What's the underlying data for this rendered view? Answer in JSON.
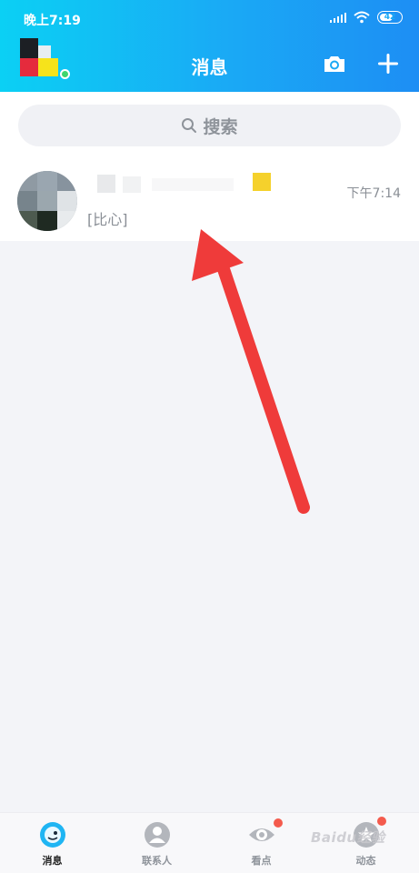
{
  "status_bar": {
    "time": "晚上7:19",
    "battery": "42"
  },
  "header": {
    "title": "消息"
  },
  "search": {
    "placeholder": "搜索"
  },
  "conversations": [
    {
      "preview": "[比心]",
      "time": "下午7:14"
    }
  ],
  "tabs": [
    {
      "label": "消息",
      "active": true
    },
    {
      "label": "联系人",
      "active": false
    },
    {
      "label": "看点",
      "active": false
    },
    {
      "label": "动态",
      "active": false
    }
  ],
  "watermark": "Baidu经验",
  "colors": {
    "header_start": "#0bd0f4",
    "header_end": "#1d8ef4",
    "arrow": "#ef3b3a",
    "badge": "#f45b4d"
  }
}
